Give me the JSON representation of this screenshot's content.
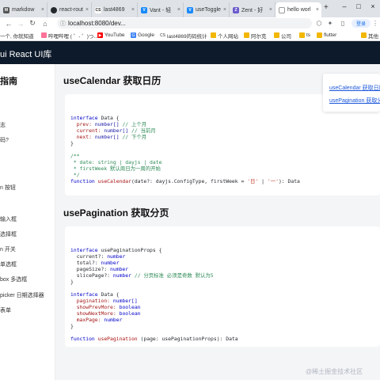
{
  "browser": {
    "tabs": [
      {
        "label": "markdow",
        "icon": "markdown-favicon",
        "color": "#555555"
      },
      {
        "label": "react-rout",
        "icon": "github-favicon",
        "color": "#24292e"
      },
      {
        "label": "last4869",
        "icon": "cs-favicon",
        "color": "#333333"
      },
      {
        "label": "Vant - 轻",
        "icon": "vant-favicon",
        "color": "#1989fa"
      },
      {
        "label": "useToggle",
        "icon": "vue-favicon",
        "color": "#1989fa"
      },
      {
        "label": "Zent - 好",
        "icon": "zent-favicon",
        "color": "#6a5acd"
      },
      {
        "label": "hello worl",
        "icon": "page-favicon",
        "color": "#888888"
      }
    ],
    "new_tab": "+",
    "url": "localhost:8080/dev...",
    "login_label": "登录",
    "bookmarks": [
      {
        "label": "一个, 你就知道"
      },
      {
        "label": "哔哩哔哩 ( ゜- ゜)つ..."
      },
      {
        "label": "YouTube"
      },
      {
        "label": "Google"
      },
      {
        "label": "last4869的码统计"
      },
      {
        "label": "个人网站"
      },
      {
        "label": "阿尔克"
      },
      {
        "label": "公司"
      },
      {
        "label": "ts"
      },
      {
        "label": "flutter"
      },
      {
        "label": "其他"
      }
    ]
  },
  "app": {
    "title": "ui React UI库"
  },
  "sidebar": {
    "title": "指南",
    "items": [
      "志",
      "码?",
      "n 按钮",
      "输入框",
      "选择框",
      "n 开关",
      "单选框",
      "box 多选框",
      "picker 日期选择器",
      "表单"
    ]
  },
  "main": {
    "section1_title": "useCalendar 获取日历",
    "section2_title": "usePagination 获取分页"
  },
  "anchors": {
    "link1": "useCalendar 获取日历",
    "link2": "usePagination 获取分"
  },
  "code1": {
    "iface": "interface",
    "data": "Data {",
    "prev_key": "prev:",
    "prev_type": "number[]",
    "prev_cm": "// 上个月",
    "cur_key": "current:",
    "cur_type": "number[]",
    "cur_cm": "// 当前月",
    "next_key": "next:",
    "next_type": "number[]",
    "next_cm": "// 下个月",
    "close": "}",
    "c1": "/**",
    "c2": " * date: string | dayjs | date",
    "c3": " * firstWeek 默认周日为一周的开始",
    "c4": " */",
    "fn_kw": "function",
    "fn_name": "useCalendar",
    "fn_params": "(date?: dayjs.ConfigType, firstWeek =",
    "fn_str1": "'日'",
    "fn_pipe": "|",
    "fn_str2": "'一'",
    "fn_ret": "): Data"
  },
  "code2": {
    "iface": "interface",
    "props_name": "usePaginationProps {",
    "current": "current?:",
    "total": "total?:",
    "pageSize": "pageSize?:",
    "slicePage": "slicePage?:",
    "num": "number",
    "slice_cm": "// 分页标准 必须是奇数 默认为5",
    "close": "}",
    "data": "Data {",
    "pagination": "pagination:",
    "pagination_type": "number[]",
    "showPrev": "showPrevMore:",
    "showNext": "showNextMore:",
    "bool": "boolean",
    "maxPage": "maxPage:",
    "fn_kw": "function",
    "fn_name": "usePagination",
    "fn_params": "(page: usePaginationProps): Data"
  },
  "watermark": "@稀土掘金技术社区"
}
